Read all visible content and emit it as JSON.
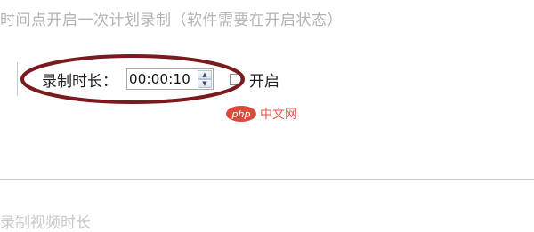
{
  "top_hint": "时间点开启一次计划录制（软件需要在开启状态）",
  "recording": {
    "duration_label": "录制时长：",
    "duration_value": "00:00:10",
    "enable_label": "开启",
    "enable_checked": false
  },
  "spinner": {
    "up_icon": "caret-up-icon",
    "down_icon": "caret-down-icon"
  },
  "watermark": {
    "logo": "php",
    "text": "中文网"
  },
  "bottom_hint": "录制视频时长",
  "colors": {
    "annotation_ellipse": "#7a1a1f",
    "watermark_red": "#d94c3d",
    "hint_gray": "#b3b3b3"
  }
}
